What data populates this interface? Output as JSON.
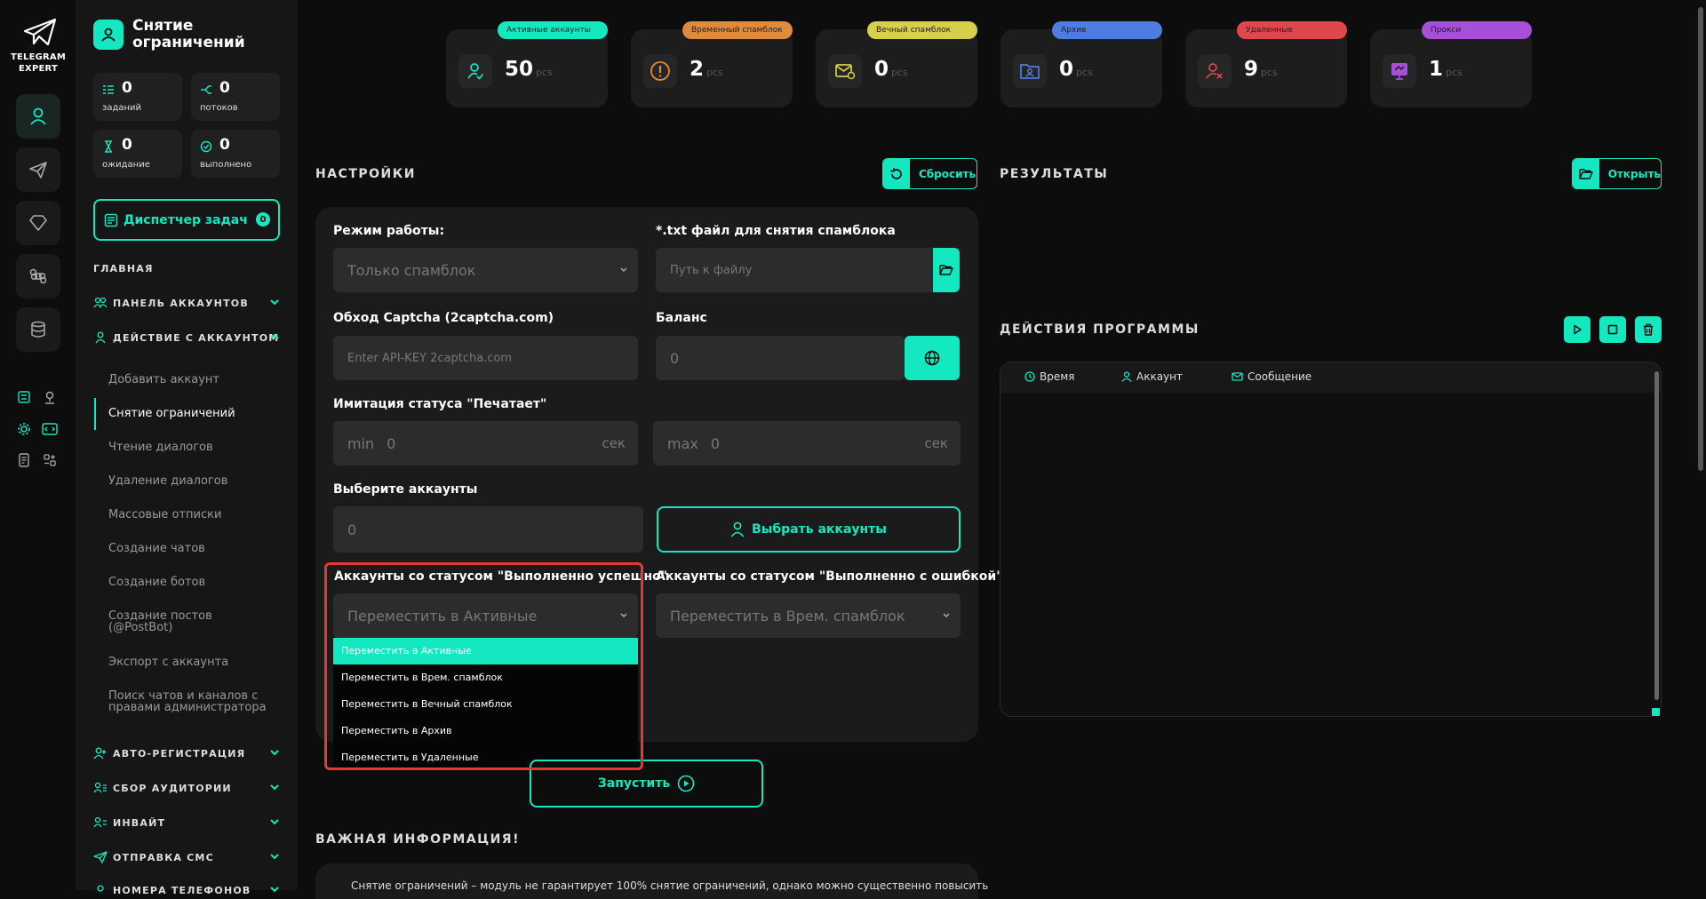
{
  "app": {
    "logo_line1": "TELEGRAM",
    "logo_line2": "EXPERT",
    "page_title": "Снятие ограничений"
  },
  "sidebar": {
    "stats": [
      {
        "value": "0",
        "label": "заданий"
      },
      {
        "value": "0",
        "label": "потоков"
      },
      {
        "value": "0",
        "label": "ожидание"
      },
      {
        "value": "0",
        "label": "выполнено"
      }
    ],
    "dispatcher_label": "Диспетчер задач",
    "dispatcher_count": "0",
    "section_main": "ГЛАВНАЯ",
    "groups": [
      {
        "label": "ПАНЕЛЬ АККАУНТОВ"
      },
      {
        "label": "ДЕЙСТВИЕ С АККАУНТОМ"
      },
      {
        "label": "АВТО-РЕГИСТРАЦИЯ"
      },
      {
        "label": "СБОР АУДИТОРИИ"
      },
      {
        "label": "ИНВАЙТ"
      },
      {
        "label": "ОТПРАВКА СМС"
      },
      {
        "label": "НОМЕРА ТЕЛЕФОНОВ"
      }
    ],
    "sub_items": [
      "Добавить аккаунт",
      "Снятие ограничений",
      "Чтение диалогов",
      "Удаление диалогов",
      "Массовые отписки",
      "Создание чатов",
      "Создание ботов",
      "Создание постов (@PostBot)",
      "Экспорт с аккаунта",
      "Поиск чатов и каналов с правами администратора"
    ]
  },
  "cards": [
    {
      "pill": "Активные аккаунты",
      "value": "50",
      "unit": "pcs",
      "color": "#14e8c1"
    },
    {
      "pill": "Временный спамблок",
      "value": "2",
      "unit": "pcs",
      "color": "#e08a3c"
    },
    {
      "pill": "Вечный спамблок",
      "value": "0",
      "unit": "pcs",
      "color": "#d8cf4a"
    },
    {
      "pill": "Архив",
      "value": "0",
      "unit": "pcs",
      "color": "#4f7ce0"
    },
    {
      "pill": "Удаленные",
      "value": "9",
      "unit": "pcs",
      "color": "#e0474d"
    },
    {
      "pill": "Прокси",
      "value": "1",
      "unit": "pcs",
      "color": "#a64fd9"
    }
  ],
  "settings": {
    "heading": "НАСТРОЙКИ",
    "reset_label": "Сбросить",
    "mode_label": "Режим работы:",
    "mode_value": "Только спамблок",
    "file_label": "*.txt файл для снятия спамблока",
    "file_placeholder": "Путь к файлу",
    "captcha_label": "Обход Captcha (2captcha.com)",
    "captcha_placeholder": "Enter API-KEY 2captcha.com",
    "balance_label": "Баланс",
    "balance_value": "0",
    "typing_label": "Имитация статуса \"Печатает\"",
    "min_prefix": "min",
    "min_value": "0",
    "max_prefix": "max",
    "max_value": "0",
    "unit_sec": "сек",
    "accounts_label": "Выберите аккаунты",
    "accounts_value": "0",
    "select_accounts_label": "Выбрать аккаунты",
    "success_label": "Аккаунты со статусом \"Выполненно успешно\"",
    "success_value": "Переместить в Активные",
    "error_label": "Аккаунты со статусом \"Выполненно с ошибкой\"",
    "error_value": "Переместить в Врем. спамблок",
    "dropdown_options": [
      "Переместить в Активные",
      "Переместить в Врем. спамблок",
      "Переместить в Вечный спамблок",
      "Переместить в Архив",
      "Переместить в Удаленные"
    ],
    "run_label": "Запустить"
  },
  "info": {
    "heading": "ВАЖНАЯ ИНФОРМАЦИЯ!",
    "text": "Снятие ограничений – модуль не гарантирует 100% снятие ограничений, однако можно существенно повысить"
  },
  "results": {
    "heading": "РЕЗУЛЬТАТЫ",
    "open_label": "Открыть"
  },
  "actions": {
    "heading": "ДЕЙСТВИЯ ПРОГРАММЫ",
    "col_time": "Время",
    "col_account": "Аккаунт",
    "col_message": "Сообщение"
  },
  "colors": {
    "accent": "#14e8c1",
    "highlight": "#e5363a"
  }
}
